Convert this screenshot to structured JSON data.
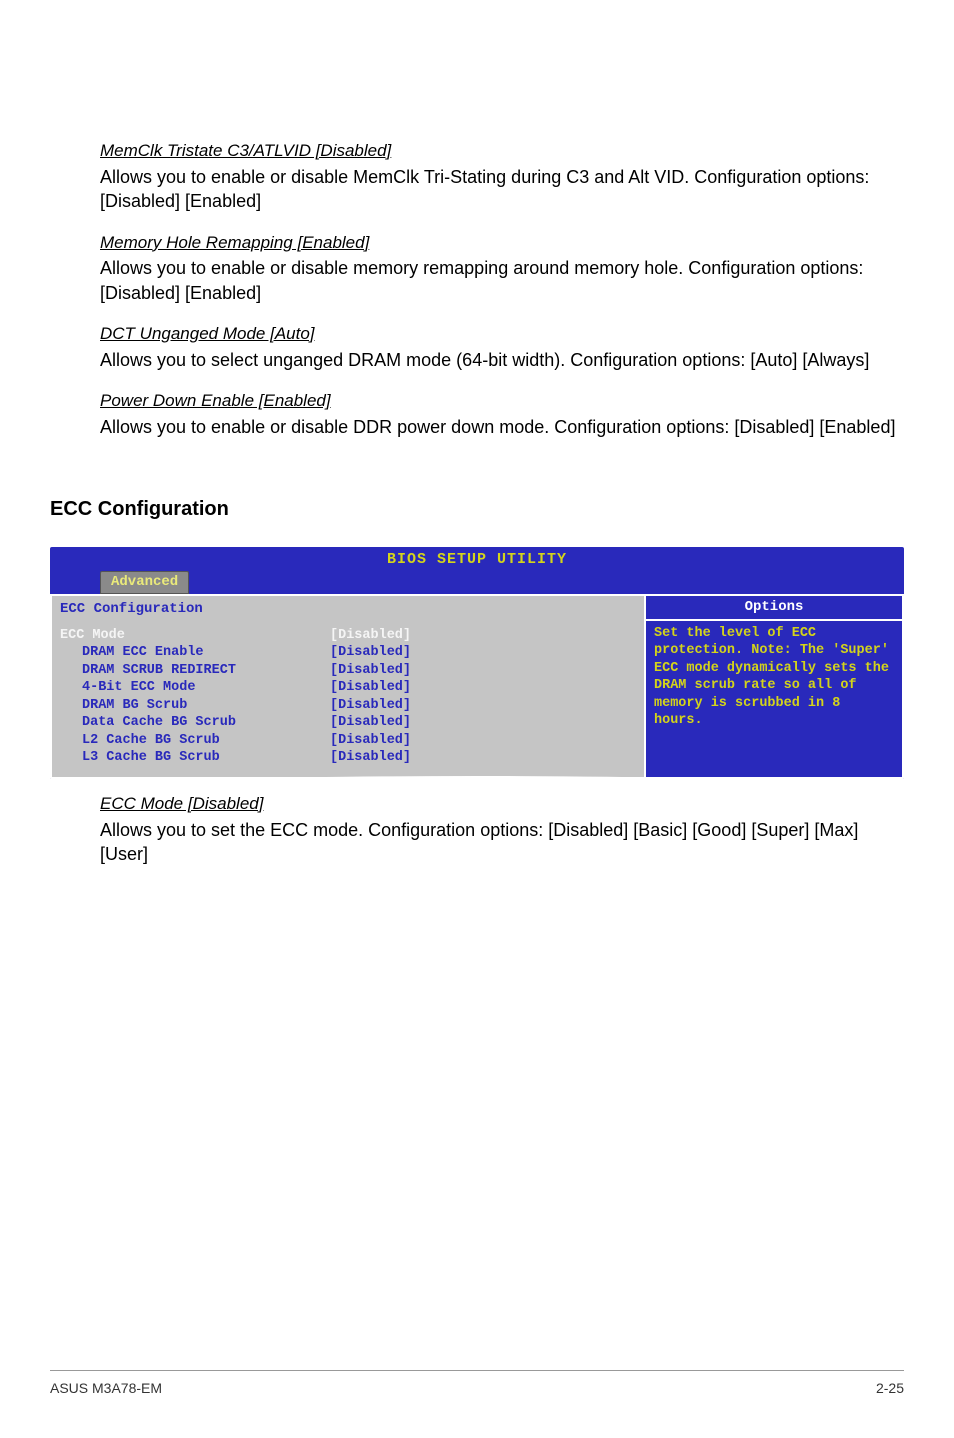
{
  "items": [
    {
      "title": "MemClk Tristate C3/ATLVID [Disabled]",
      "desc": "Allows you to enable or disable MemClk Tri-Stating during C3 and Alt VID. Configuration options: [Disabled] [Enabled]"
    },
    {
      "title": "Memory Hole Remapping [Enabled]",
      "desc": "Allows you to enable or disable memory remapping around memory hole. Configuration options: [Disabled] [Enabled]"
    },
    {
      "title": "DCT Unganged Mode [Auto]",
      "desc": "Allows you to select unganged DRAM mode (64-bit width). Configuration options: [Auto] [Always]"
    },
    {
      "title": "Power Down Enable [Enabled]",
      "desc": "Allows you to enable or disable DDR power down mode. Configuration options: [Disabled] [Enabled]"
    }
  ],
  "ecc_heading": "ECC Configuration",
  "bios": {
    "title": "BIOS SETUP UTILITY",
    "tab": "Advanced",
    "section_title": "ECC Configuration",
    "options_label": "Options",
    "help_text": "Set the level of ECC protection. Note: The 'Super' ECC mode dynamically sets the DRAM scrub rate so all of memory is scrubbed in 8 hours.",
    "rows": [
      {
        "label": "ECC Mode",
        "value": "[Disabled]",
        "selected": true,
        "indent": false
      },
      {
        "label": "DRAM ECC Enable",
        "value": "[Disabled]",
        "selected": false,
        "indent": true
      },
      {
        "label": "DRAM SCRUB REDIRECT",
        "value": "[Disabled]",
        "selected": false,
        "indent": true
      },
      {
        "label": "4-Bit ECC Mode",
        "value": "[Disabled]",
        "selected": false,
        "indent": true
      },
      {
        "label": "DRAM BG Scrub",
        "value": "[Disabled]",
        "selected": false,
        "indent": true
      },
      {
        "label": "Data Cache BG Scrub",
        "value": "[Disabled]",
        "selected": false,
        "indent": true
      },
      {
        "label": "L2 Cache BG Scrub",
        "value": "[Disabled]",
        "selected": false,
        "indent": true
      },
      {
        "label": "L3 Cache BG Scrub",
        "value": "[Disabled]",
        "selected": false,
        "indent": true
      }
    ]
  },
  "ecc_mode": {
    "title": "ECC Mode [Disabled]",
    "desc": "Allows you to set the ECC mode. Configuration options: [Disabled] [Basic] [Good] [Super] [Max] [User]"
  },
  "footer": {
    "left": "ASUS M3A78-EM",
    "right": "2-25"
  }
}
